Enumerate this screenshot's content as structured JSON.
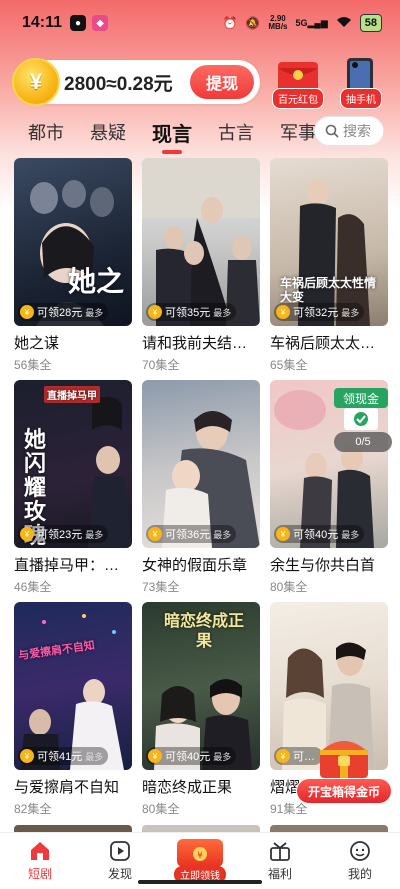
{
  "status_bar": {
    "time": "14:11",
    "net_speed_value": "2.90",
    "net_speed_unit": "MB/s",
    "signal_label": "5G",
    "battery": "58"
  },
  "coin_bar": {
    "text": "2800≈0.28元",
    "coin_symbol": "¥",
    "withdraw_label": "提现"
  },
  "promos": [
    {
      "label": "百元红包",
      "icon": "red-envelope-icon"
    },
    {
      "label": "抽手机",
      "icon": "phone-prize-icon"
    }
  ],
  "tabs": [
    "都市",
    "悬疑",
    "现言",
    "古言",
    "军事"
  ],
  "active_tab": "现言",
  "search": {
    "label": "搜索"
  },
  "cards": [
    {
      "title": "她之谋",
      "episodes": "56集全",
      "reward": "可领28元",
      "reward_max": "最多",
      "art": "她之"
    },
    {
      "title": "请和我前夫结…",
      "episodes": "70集全",
      "reward": "可领35元",
      "reward_max": "最多",
      "art": ""
    },
    {
      "title": "车祸后顾太太…",
      "episodes": "65集全",
      "reward": "可领32元",
      "reward_max": "最多",
      "art": "车祸后顾太太性情大变"
    },
    {
      "title": "直播掉马甲：…",
      "episodes": "46集全",
      "reward": "可领23元",
      "reward_max": "最多",
      "art": "她闪耀玫瑰",
      "art_top": "直播掉马甲"
    },
    {
      "title": "女神的假面乐章",
      "episodes": "73集全",
      "reward": "可领36元",
      "reward_max": "最多",
      "art": ""
    },
    {
      "title": "余生与你共白首",
      "episodes": "80集全",
      "reward": "可领40元",
      "reward_max": "最多",
      "art": ""
    },
    {
      "title": "与爱擦肩不自知",
      "episodes": "82集全",
      "reward": "可领41元",
      "reward_max": "最多",
      "art": "与爱擦肩不自知"
    },
    {
      "title": "暗恋终成正果",
      "episodes": "80集全",
      "reward": "可领40元",
      "reward_max": "最多",
      "art": "暗恋终成正果"
    },
    {
      "title": "熠熠…",
      "episodes": "91集全",
      "reward": "可…",
      "reward_max": "",
      "art": ""
    }
  ],
  "floating": {
    "bonus_label": "领现金",
    "progress": "0/5",
    "chest_label": "开宝箱得金币"
  },
  "bottom_nav": [
    {
      "label": "短剧",
      "icon": "home-icon"
    },
    {
      "label": "发现",
      "icon": "play-icon"
    },
    {
      "label": "立即领钱",
      "icon": "money-bag-icon"
    },
    {
      "label": "福利",
      "icon": "gift-icon"
    },
    {
      "label": "我的",
      "icon": "profile-icon"
    }
  ],
  "active_nav": "短剧",
  "colors": {
    "accent": "#f0393d",
    "gradient_top": "#f46a6a"
  }
}
